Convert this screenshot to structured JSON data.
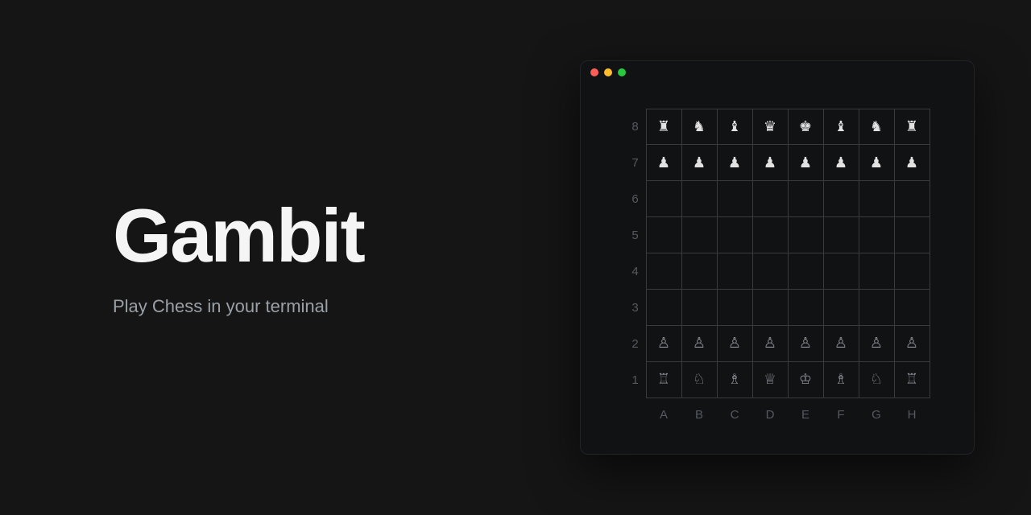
{
  "hero": {
    "title": "Gambit",
    "subtitle": "Play Chess in your terminal"
  },
  "board": {
    "rank_labels": [
      "8",
      "7",
      "6",
      "5",
      "4",
      "3",
      "2",
      "1"
    ],
    "file_labels": [
      "A",
      "B",
      "C",
      "D",
      "E",
      "F",
      "G",
      "H"
    ],
    "squares": [
      [
        {
          "glyph": "♜",
          "side": "white"
        },
        {
          "glyph": "♞",
          "side": "white"
        },
        {
          "glyph": "♝",
          "side": "white"
        },
        {
          "glyph": "♛",
          "side": "white"
        },
        {
          "glyph": "♚",
          "side": "white"
        },
        {
          "glyph": "♝",
          "side": "white"
        },
        {
          "glyph": "♞",
          "side": "white"
        },
        {
          "glyph": "♜",
          "side": "white"
        }
      ],
      [
        {
          "glyph": "♟",
          "side": "white"
        },
        {
          "glyph": "♟",
          "side": "white"
        },
        {
          "glyph": "♟",
          "side": "white"
        },
        {
          "glyph": "♟",
          "side": "white"
        },
        {
          "glyph": "♟",
          "side": "white"
        },
        {
          "glyph": "♟",
          "side": "white"
        },
        {
          "glyph": "♟",
          "side": "white"
        },
        {
          "glyph": "♟",
          "side": "white"
        }
      ],
      [
        {
          "glyph": "",
          "side": ""
        },
        {
          "glyph": "",
          "side": ""
        },
        {
          "glyph": "",
          "side": ""
        },
        {
          "glyph": "",
          "side": ""
        },
        {
          "glyph": "",
          "side": ""
        },
        {
          "glyph": "",
          "side": ""
        },
        {
          "glyph": "",
          "side": ""
        },
        {
          "glyph": "",
          "side": ""
        }
      ],
      [
        {
          "glyph": "",
          "side": ""
        },
        {
          "glyph": "",
          "side": ""
        },
        {
          "glyph": "",
          "side": ""
        },
        {
          "glyph": "",
          "side": ""
        },
        {
          "glyph": "",
          "side": ""
        },
        {
          "glyph": "",
          "side": ""
        },
        {
          "glyph": "",
          "side": ""
        },
        {
          "glyph": "",
          "side": ""
        }
      ],
      [
        {
          "glyph": "",
          "side": ""
        },
        {
          "glyph": "",
          "side": ""
        },
        {
          "glyph": "",
          "side": ""
        },
        {
          "glyph": "",
          "side": ""
        },
        {
          "glyph": "",
          "side": ""
        },
        {
          "glyph": "",
          "side": ""
        },
        {
          "glyph": "",
          "side": ""
        },
        {
          "glyph": "",
          "side": ""
        }
      ],
      [
        {
          "glyph": "",
          "side": ""
        },
        {
          "glyph": "",
          "side": ""
        },
        {
          "glyph": "",
          "side": ""
        },
        {
          "glyph": "",
          "side": ""
        },
        {
          "glyph": "",
          "side": ""
        },
        {
          "glyph": "",
          "side": ""
        },
        {
          "glyph": "",
          "side": ""
        },
        {
          "glyph": "",
          "side": ""
        }
      ],
      [
        {
          "glyph": "♙",
          "side": "black"
        },
        {
          "glyph": "♙",
          "side": "black"
        },
        {
          "glyph": "♙",
          "side": "black"
        },
        {
          "glyph": "♙",
          "side": "black"
        },
        {
          "glyph": "♙",
          "side": "black"
        },
        {
          "glyph": "♙",
          "side": "black"
        },
        {
          "glyph": "♙",
          "side": "black"
        },
        {
          "glyph": "♙",
          "side": "black"
        }
      ],
      [
        {
          "glyph": "♖",
          "side": "black"
        },
        {
          "glyph": "♘",
          "side": "black"
        },
        {
          "glyph": "♗",
          "side": "black"
        },
        {
          "glyph": "♕",
          "side": "black"
        },
        {
          "glyph": "♔",
          "side": "black"
        },
        {
          "glyph": "♗",
          "side": "black"
        },
        {
          "glyph": "♘",
          "side": "black"
        },
        {
          "glyph": "♖",
          "side": "black"
        }
      ]
    ]
  }
}
